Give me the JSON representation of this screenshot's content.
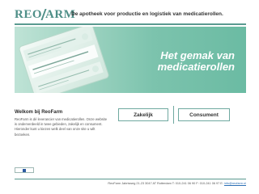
{
  "header": {
    "logo_left": "REO",
    "logo_right": "ARM",
    "tagline": "De apotheek voor productie en logistiek van medicatierollen."
  },
  "banner": {
    "title_line1": "Het gemak van",
    "title_line2": "medicatierollen"
  },
  "welcome": {
    "title": "Welkom bij ReoFarm",
    "body": "ReoFarm is dé leverancier van medicatierollen. Onze website is onderverdeeld in twee gebieden, zakelijk en consument. Hieronder kunt u kiezen welk deel van onze site u wilt bezoeken."
  },
  "buttons": {
    "zakelijk": "Zakelijk",
    "consument": "Consument"
  },
  "footer": {
    "address": "ReoFarm Jabrisweg 21-23 3047 AT Rotterdam T: 010-241 06 90 F: 010-241 06 97 E: ",
    "email": "info@reofarm.nl"
  },
  "colors": {
    "brand": "#4f8f88",
    "banner_text": "#ffffff"
  }
}
